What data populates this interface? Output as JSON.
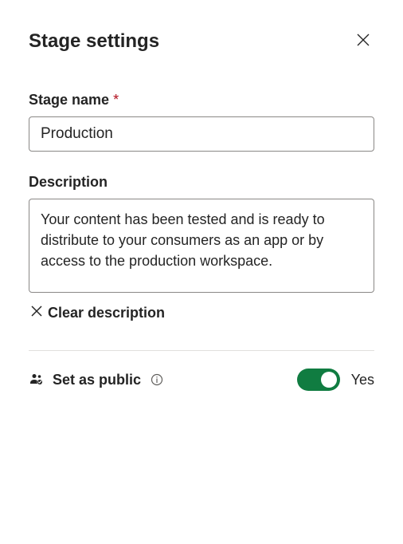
{
  "header": {
    "title": "Stage settings"
  },
  "stageName": {
    "label": "Stage name",
    "requiredMark": "*",
    "value": "Production"
  },
  "description": {
    "label": "Description",
    "value": "Your content has been tested and is ready to distribute to your consumers as an app or by access to the production workspace.",
    "clearLabel": "Clear description"
  },
  "setPublic": {
    "label": "Set as public",
    "toggleState": "Yes"
  }
}
